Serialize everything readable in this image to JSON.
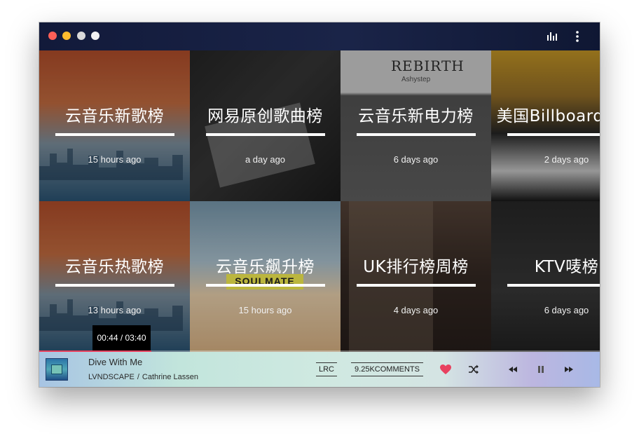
{
  "titlebar": {
    "icons": [
      "close-dot",
      "minimize-dot",
      "zoom-dot",
      "extra-dot",
      "bar-chart-icon",
      "more-vertical-icon"
    ]
  },
  "charts": [
    {
      "title": "云音乐新歌榜",
      "updated": "15 hours ago"
    },
    {
      "title": "网易原创歌曲榜",
      "updated": "a day ago"
    },
    {
      "title": "云音乐新电力榜",
      "updated": "6 days ago"
    },
    {
      "title": "美国Billboard周榜",
      "updated": "2 days ago"
    },
    {
      "title": "云音乐热歌榜",
      "updated": "13 hours ago"
    },
    {
      "title": "云音乐飙升榜",
      "updated": "15 hours ago"
    },
    {
      "title": "UK排行榜周榜",
      "updated": "4 days ago"
    },
    {
      "title": "KTV唛榜",
      "updated": "6 days ago"
    }
  ],
  "artwork_text": {
    "rebirth": "REBIRTH",
    "rebirth_sub": "Ashystep",
    "soulmate": "SOULMATE"
  },
  "player": {
    "time_display": "00:44 / 03:40",
    "progress": 0.2,
    "song": "Dive With Me",
    "artist_1": "LVNDSCAPE",
    "separator": "/",
    "artist_2": "Cathrine Lassen",
    "lrc_label": "LRC",
    "comments_label": "9.25KCOMMENTS",
    "liked": true,
    "accent_color": "#e8415f"
  }
}
